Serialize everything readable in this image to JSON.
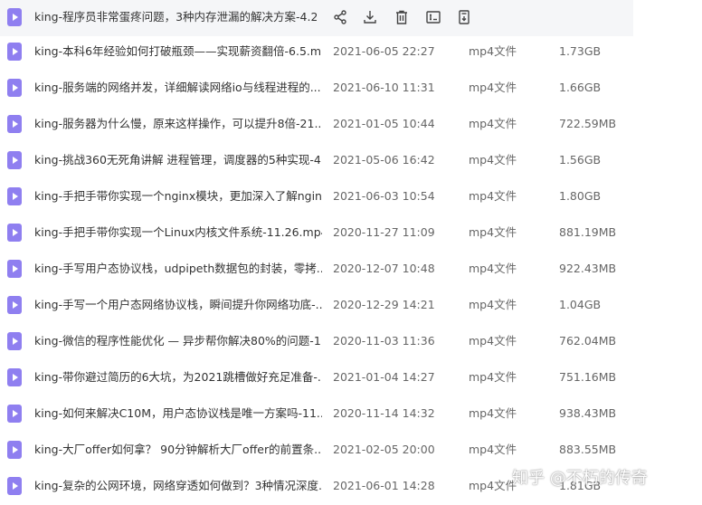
{
  "files": [
    {
      "name": "king-程序员非常蛋疼问题，3种内存泄漏的解决方案-4.2...",
      "date": "",
      "type": "",
      "size": ""
    },
    {
      "name": "king-本科6年经验如何打破瓶颈——实现薪资翻倍-6.5.m...",
      "date": "2021-06-05 22:27",
      "type": "mp4文件",
      "size": "1.73GB"
    },
    {
      "name": "king-服务端的网络并发，详细解读网络io与线程进程的...",
      "date": "2021-06-10 11:31",
      "type": "mp4文件",
      "size": "1.66GB"
    },
    {
      "name": "king-服务器为什么慢，原来这样操作，可以提升8倍-21....",
      "date": "2021-01-05 10:44",
      "type": "mp4文件",
      "size": "722.59MB"
    },
    {
      "name": "king-挑战360无死角讲解 进程管理，调度器的5种实现-4...",
      "date": "2021-05-06 16:42",
      "type": "mp4文件",
      "size": "1.56GB"
    },
    {
      "name": "king-手把手带你实现一个nginx模块，更加深入了解ngin...",
      "date": "2021-06-03 10:54",
      "type": "mp4文件",
      "size": "1.80GB"
    },
    {
      "name": "king-手把手带你实现一个Linux内核文件系统-11.26.mp4",
      "date": "2020-11-27 11:09",
      "type": "mp4文件",
      "size": "881.19MB"
    },
    {
      "name": "king-手写用户态协议栈，udpipeth数据包的封装，零拷...",
      "date": "2020-12-07 10:48",
      "type": "mp4文件",
      "size": "922.43MB"
    },
    {
      "name": "king-手写一个用户态网络协议栈，瞬间提升你网络功底-...",
      "date": "2020-12-29 14:21",
      "type": "mp4文件",
      "size": "1.04GB"
    },
    {
      "name": "king-微信的程序性能优化 — 异步帮你解决80%的问题-1...",
      "date": "2020-11-03 11:36",
      "type": "mp4文件",
      "size": "762.04MB"
    },
    {
      "name": "king-带你避过简历的6大坑，为2021跳槽做好充足准备-...",
      "date": "2021-01-04 14:27",
      "type": "mp4文件",
      "size": "751.16MB"
    },
    {
      "name": "king-如何来解决C10M，用户态协议栈是唯一方案吗-11....",
      "date": "2020-11-14 14:32",
      "type": "mp4文件",
      "size": "938.43MB"
    },
    {
      "name": "king-大厂offer如何拿？ 90分钟解析大厂offer的前置条...",
      "date": "2021-02-05 20:00",
      "type": "mp4文件",
      "size": "883.55MB"
    },
    {
      "name": "king-复杂的公网环境，网络穿透如何做到？3种情况深度...",
      "date": "2021-06-01 14:28",
      "type": "mp4文件",
      "size": "1.81GB"
    }
  ],
  "watermark": "知乎 @不朽的传奇",
  "icons": {
    "file": "video-file-icon",
    "share": "share-icon",
    "download": "download-icon",
    "delete": "trash-icon",
    "rename": "rename-icon",
    "more": "move-icon"
  },
  "colors": {
    "file_icon": "#8f7ff0",
    "hover_row": "#f5f6f8"
  }
}
